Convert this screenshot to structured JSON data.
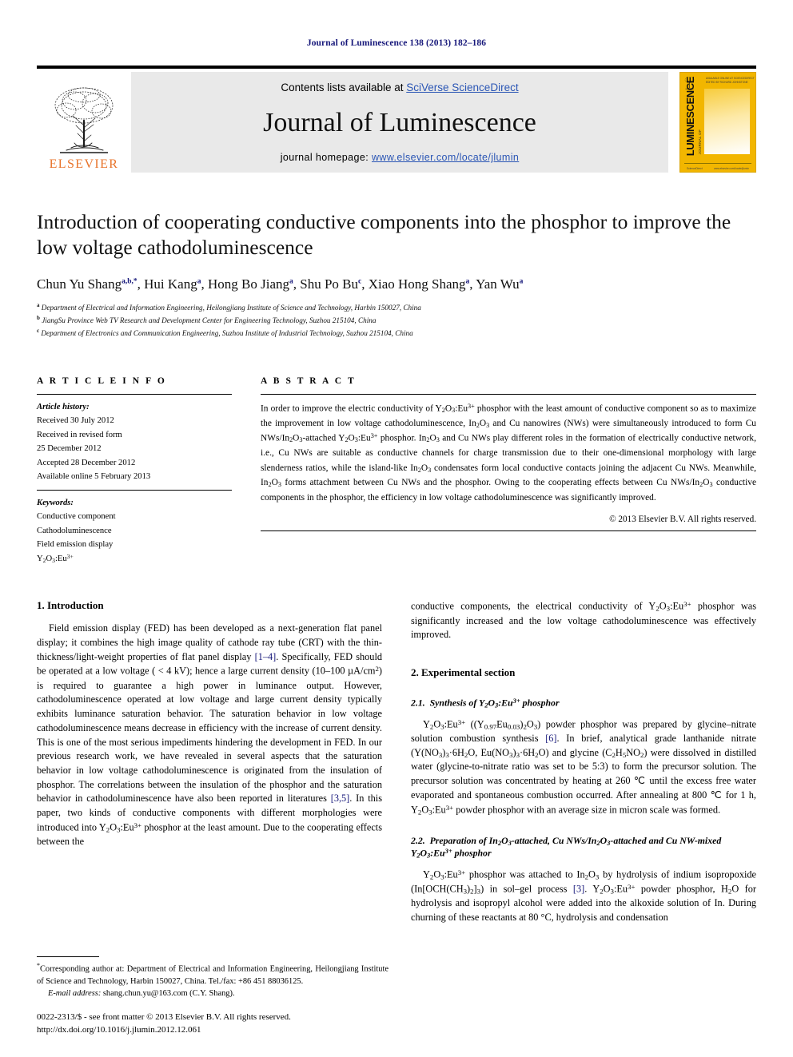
{
  "running_head": "Journal of Luminescence 138 (2013) 182–186",
  "masthead": {
    "contents_prefix": "Contents lists available at ",
    "contents_link": "SciVerse ScienceDirect",
    "journal_name": "Journal of Luminescence",
    "homepage_prefix": "journal homepage: ",
    "homepage_link": "www.elsevier.com/locate/jlumin",
    "publisher_wordmark": "ELSEVIER",
    "cover": {
      "spine_title": "LUMINESCENCE",
      "spine_small": "JOURNAL OF",
      "top_text": "AVAILABLE ONLINE AT SCIENCEDIRECT\nEDITED BY RICHARD JOHNSTONE",
      "foot_left": "ScienceDirect",
      "foot_right": "www.elsevier.com/locate/jlumin"
    }
  },
  "article": {
    "title": "Introduction of cooperating conductive components into the phosphor to improve the low voltage cathodoluminescence",
    "authors": [
      {
        "name": "Chun Yu Shang",
        "marks": "a,b,*"
      },
      {
        "name": "Hui Kang",
        "marks": "a"
      },
      {
        "name": "Hong Bo Jiang",
        "marks": "a"
      },
      {
        "name": "Shu Po Bu",
        "marks": "c"
      },
      {
        "name": "Xiao Hong Shang",
        "marks": "a"
      },
      {
        "name": "Yan Wu",
        "marks": "a"
      }
    ],
    "affiliations": [
      {
        "mark": "a",
        "text": "Department of Electrical and Information Engineering, Heilongjiang Institute of Science and Technology, Harbin 150027, China"
      },
      {
        "mark": "b",
        "text": "JiangSu Province Web TV Research and Development Center for Engineering Technology, Suzhou 215104, China"
      },
      {
        "mark": "c",
        "text": "Department of Electronics and Communication Engineering, Suzhou Institute of Industrial Technology, Suzhou 215104, China"
      }
    ]
  },
  "article_info": {
    "heading": "A R T I C L E  I N F O",
    "history_label": "Article history:",
    "history": [
      "Received 30 July 2012",
      "Received in revised form",
      "25 December 2012",
      "Accepted 28 December 2012",
      "Available online 5 February 2013"
    ],
    "keywords_label": "Keywords:",
    "keywords": [
      "Conductive component",
      "Cathodoluminescence",
      "Field emission display",
      "Y2O3:Eu3+"
    ]
  },
  "abstract": {
    "heading": "A B S T R A C T",
    "paragraph_1": "In order to improve the electric conductivity of Y",
    "copyright": "© 2013 Elsevier B.V. All rights reserved."
  },
  "sections": {
    "intro_heading": "1.  Introduction",
    "experimental_heading": "2.  Experimental section",
    "sub_2_1": "2.1.  Synthesis of Y",
    "sub_2_1_tail": " phosphor",
    "sub_2_2_a": "2.2.  Preparation of In",
    "sub_2_2_tail": " phosphor"
  },
  "footnote": {
    "corresponding": "Corresponding author at: Department of Electrical and Information Engineering, Heilongjiang Institute of Science and Technology, Harbin 150027, China. Tel./fax: +86 451 88036125.",
    "email_label": "E-mail address:",
    "email": "shang.chun.yu@163.com (C.Y. Shang)."
  },
  "footer": {
    "issn_line": "0022-2313/$ - see front matter © 2013 Elsevier B.V. All rights reserved.",
    "doi_line": "http://dx.doi.org/10.1016/j.jlumin.2012.12.061"
  },
  "colors": {
    "link_blue": "#2b56b5",
    "ref_blue": "#16177a",
    "elsevier_orange": "#e8732a",
    "cover_yellow": "#f2b600",
    "masthead_grey": "#e9e9e9"
  }
}
